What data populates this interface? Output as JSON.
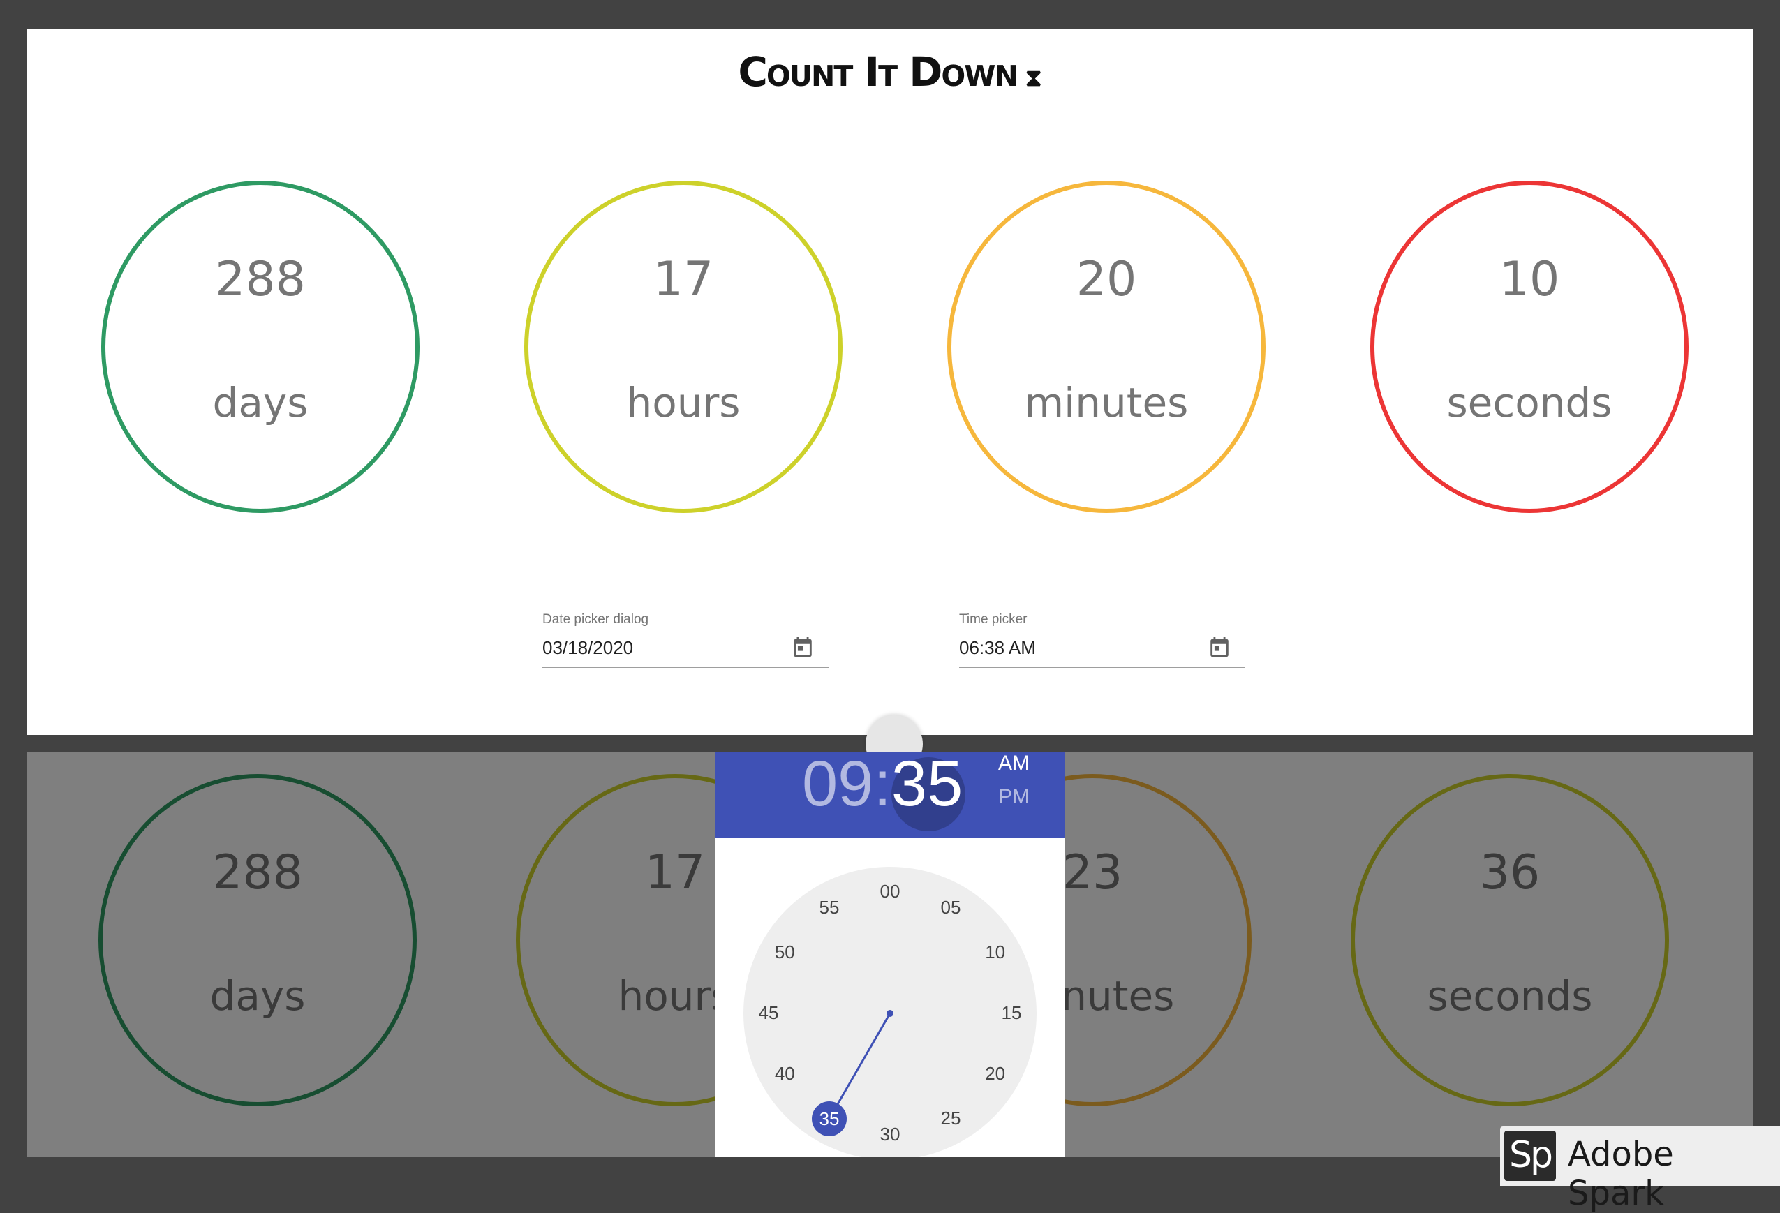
{
  "app": {
    "title": "Count It Down",
    "hourglass": "⧗"
  },
  "top_counters": [
    {
      "value": "288",
      "label": "days",
      "color": "#2e9a63"
    },
    {
      "value": "17",
      "label": "hours",
      "color": "#cdd12a"
    },
    {
      "value": "20",
      "label": "minutes",
      "color": "#f6b73c"
    },
    {
      "value": "10",
      "label": "seconds",
      "color": "#ec3535"
    }
  ],
  "date_picker": {
    "label": "Date picker dialog",
    "value": "03/18/2020",
    "icon": "calendar-icon"
  },
  "time_picker": {
    "label": "Time picker",
    "value": "06:38 AM",
    "icon": "calendar-icon"
  },
  "bottom_counters": [
    {
      "value": "288",
      "label": "days",
      "color": "#2e9a63"
    },
    {
      "value": "17",
      "label": "hours",
      "color": "#cdd12a"
    },
    {
      "value": "23",
      "label": "minutes",
      "color": "#f6b73c"
    },
    {
      "value": "36",
      "label": "seconds",
      "color": "#cdd12a"
    }
  ],
  "time_dialog": {
    "hour": "09",
    "separator": ":",
    "minute": "35",
    "am": "AM",
    "pm": "PM",
    "selected_period": "AM",
    "accent": "#3f51b5",
    "clock_numbers": [
      "00",
      "05",
      "10",
      "15",
      "20",
      "25",
      "30",
      "35",
      "40",
      "45",
      "50",
      "55"
    ],
    "selected_minute": "35"
  },
  "watermark": {
    "logo": "Sp",
    "text": "Adobe Spark"
  }
}
